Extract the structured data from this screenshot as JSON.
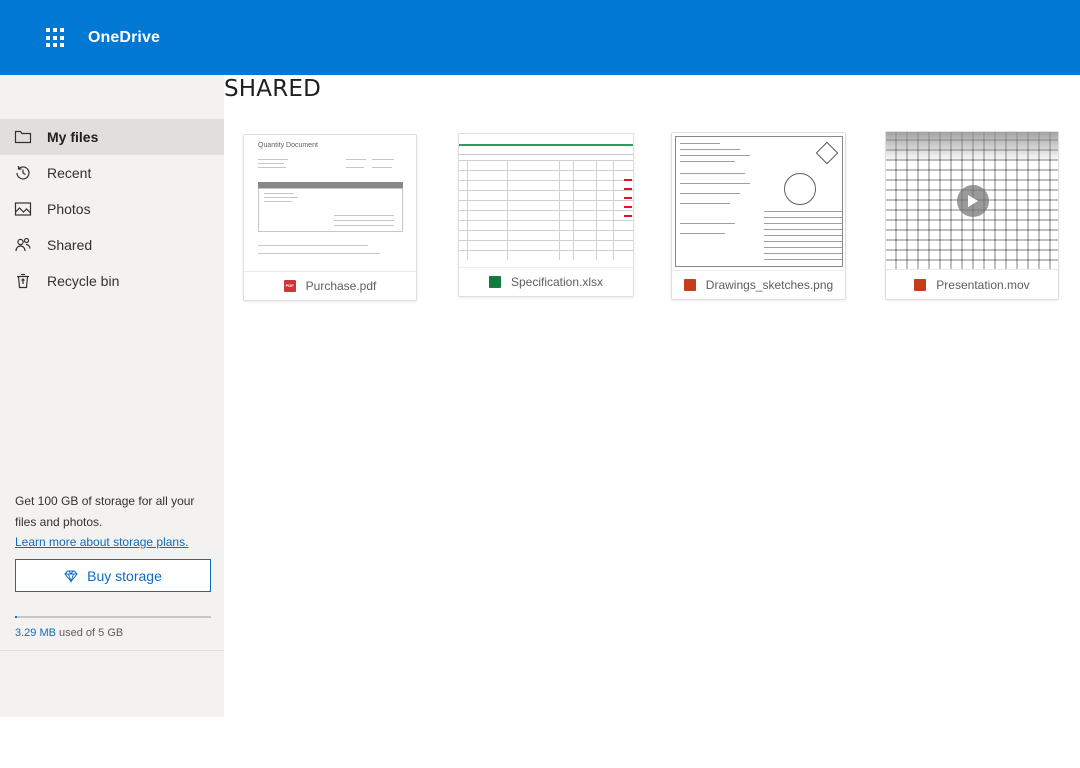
{
  "app": {
    "brand": "OneDrive",
    "accent": "#0078d4"
  },
  "sidebar": {
    "items": [
      {
        "label": "My files",
        "icon": "folder-icon",
        "active": true
      },
      {
        "label": "Recent",
        "icon": "clock-icon"
      },
      {
        "label": "Photos",
        "icon": "image-icon"
      },
      {
        "label": "Shared",
        "icon": "people-icon"
      },
      {
        "label": "Recycle bin",
        "icon": "recycle-bin-icon"
      }
    ],
    "promo_text": "Get 100 GB of storage for all your files and photos.",
    "promo_link": "Learn more about storage plans.",
    "buy_label": "Buy storage",
    "quota_used": "3.29 MB",
    "quota_rest": " used of 5 GB",
    "quota_fraction": 0.0007
  },
  "main": {
    "title": "SHARED",
    "files": [
      {
        "name": "Purchase.pdf",
        "type": "pdf",
        "thumb_title": "Quantity Document"
      },
      {
        "name": "Specification.xlsx",
        "type": "xlsx"
      },
      {
        "name": "Drawings_sketches.png",
        "type": "png"
      },
      {
        "name": "Presentation.mov",
        "type": "mov"
      }
    ]
  }
}
